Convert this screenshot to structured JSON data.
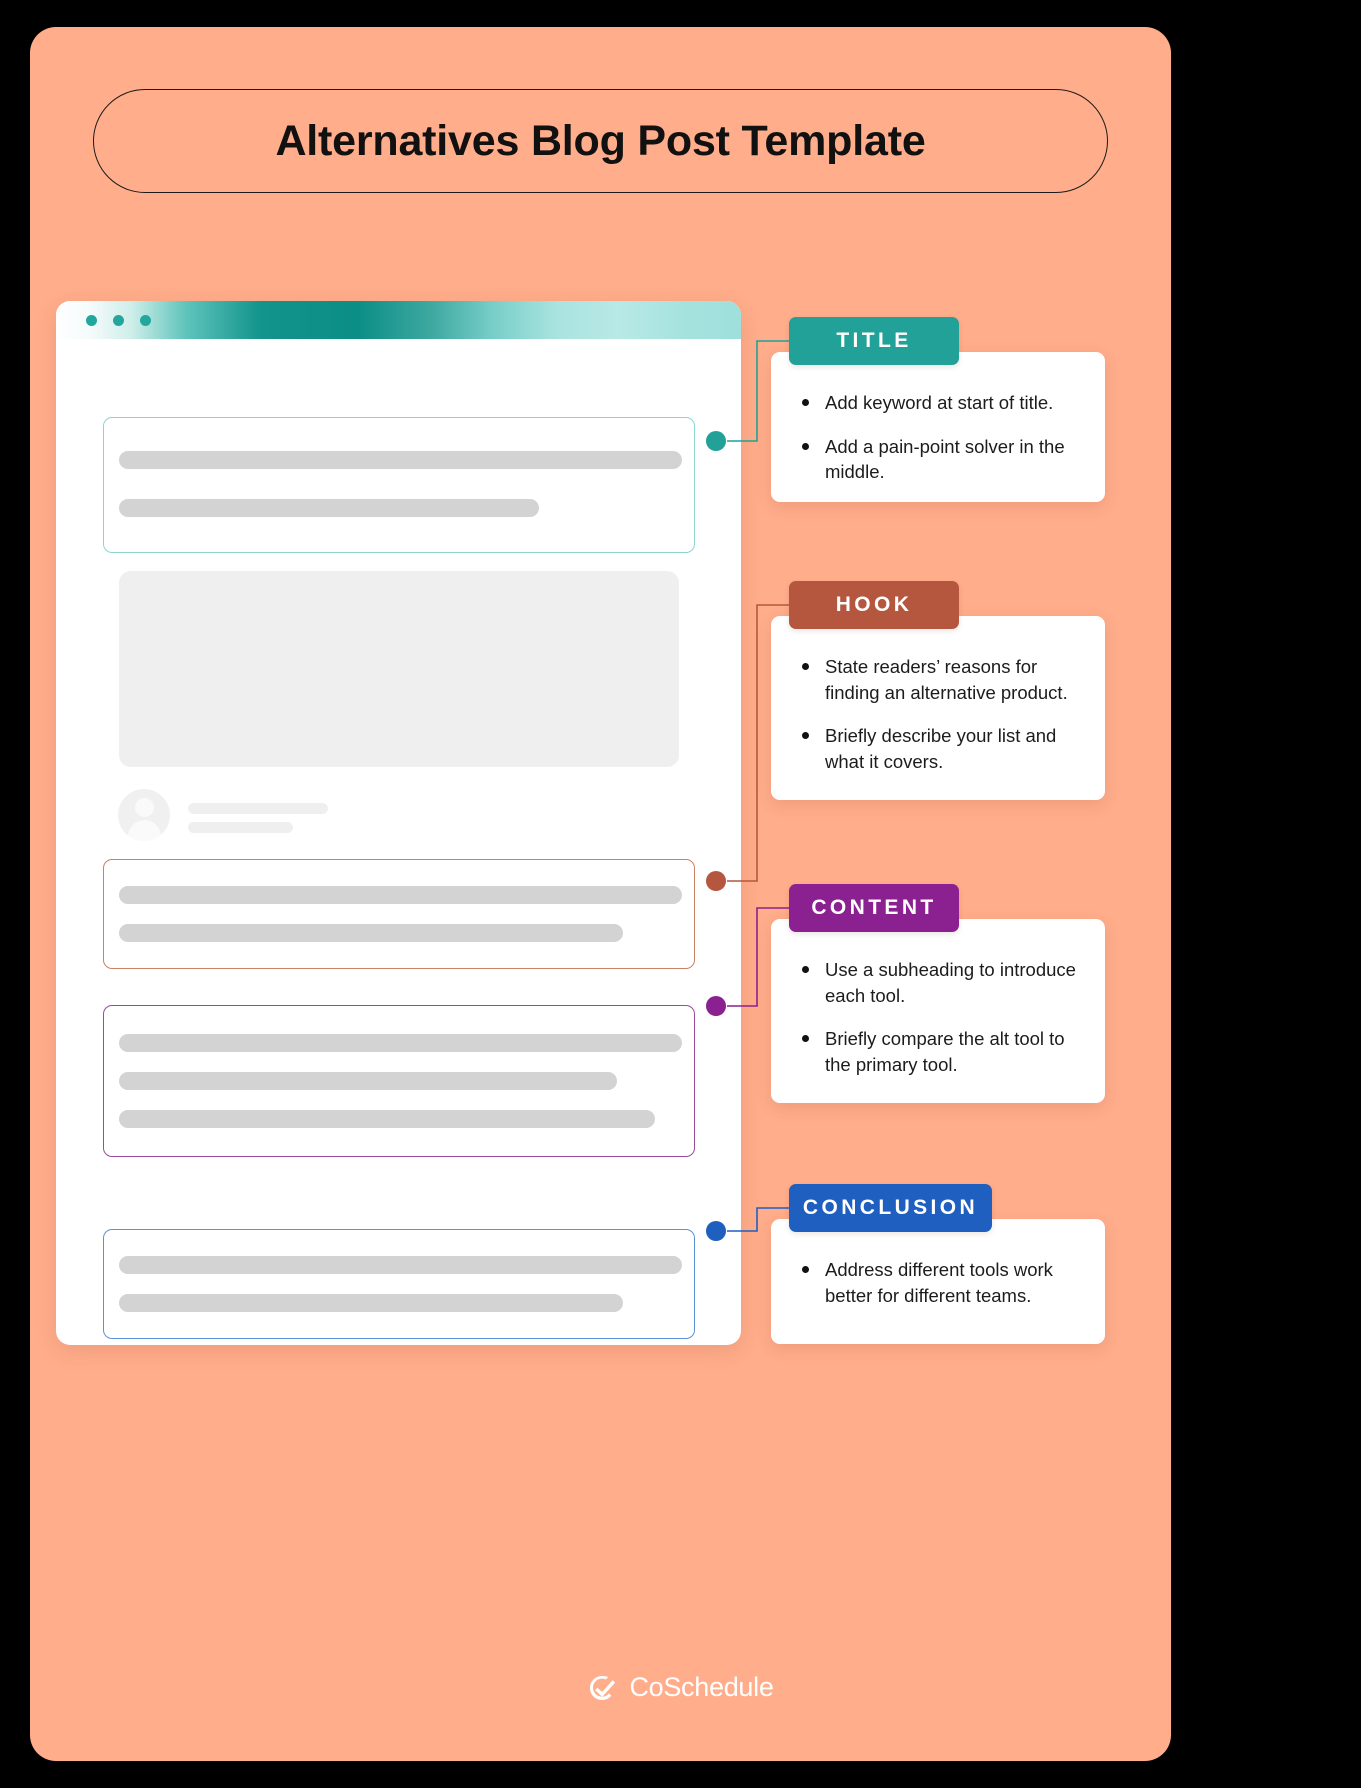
{
  "page": {
    "title": "Alternatives Blog Post Template",
    "background_color": "#000000",
    "panel_color": "#FFAD8B"
  },
  "browser_mockup": {
    "window_dots": [
      "dot-1",
      "dot-2",
      "dot-3"
    ],
    "dot_color": "#23a79c",
    "bar_gradient": "white-to-teal-to-cyan",
    "sections": [
      {
        "name": "title-block",
        "accent": "#8bd6d0",
        "lines": 2
      },
      {
        "name": "image-placeholder",
        "accent": "#efefef",
        "lines": 0
      },
      {
        "name": "author-row",
        "accent": "#efefef",
        "lines": 2
      },
      {
        "name": "hook-block",
        "accent": "#c98263",
        "lines": 2
      },
      {
        "name": "content-block",
        "accent": "#9c4a9e",
        "lines": 3
      },
      {
        "name": "conclusion-block",
        "accent": "#5b93d6",
        "lines": 2
      }
    ]
  },
  "callouts": [
    {
      "id": "title",
      "label": "TITLE",
      "color": "#21a197",
      "bullets": [
        "Add keyword at start of title.",
        "Add a pain-point solver in the middle."
      ]
    },
    {
      "id": "hook",
      "label": "HOOK",
      "color": "#b5573f",
      "bullets": [
        "State readers’ reasons for finding an alternative product.",
        "Briefly describe your list and what it covers."
      ]
    },
    {
      "id": "content",
      "label": "CONTENT",
      "color": "#8b2090",
      "bullets": [
        "Use a subheading to introduce each tool.",
        "Briefly compare the alt tool to the primary tool."
      ]
    },
    {
      "id": "conclusion",
      "label": "CONCLUSION",
      "color": "#1f5fc0",
      "bullets": [
        "Address different tools work better for different teams."
      ]
    }
  ],
  "footer": {
    "brand": "CoSchedule",
    "logo_icon": "check-circle-icon",
    "logo_color": "#ffffff"
  }
}
